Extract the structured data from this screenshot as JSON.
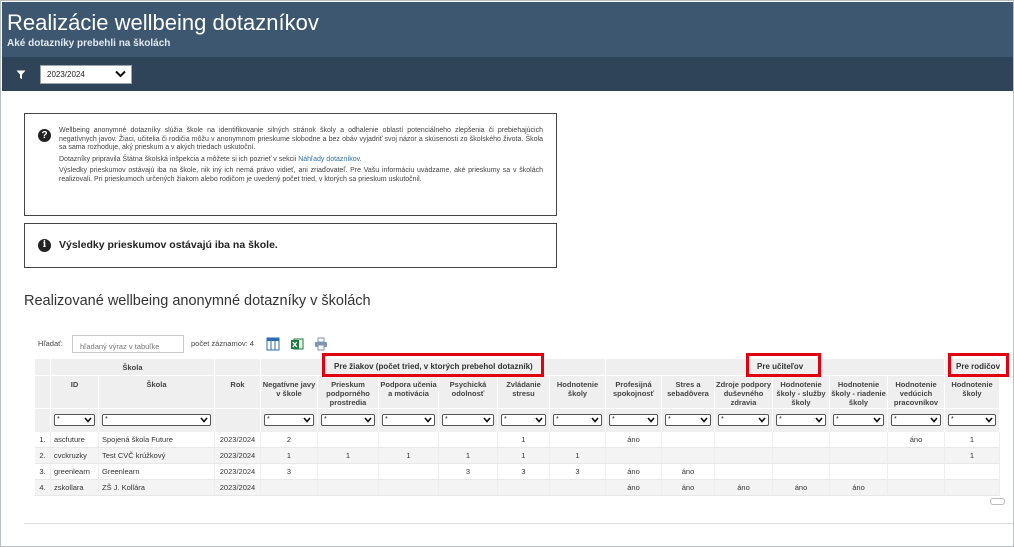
{
  "header": {
    "title": "Realizácie wellbeing dotazníkov",
    "subtitle": "Aké dotazníky prebehli na školách"
  },
  "toolbar": {
    "filter_icon": "filter-icon",
    "year": "2023/2024"
  },
  "info": {
    "p1": "Wellbeing anonymné dotazníky slúžia škole na identifikovanie silných stránok školy a odhalenie oblastí potenciálneho zlepšenia či prebiehajúcich negatívnych javov. Žiaci, učitelia či rodičia môžu v anonymnom prieskume slobodne a bez obáv vyjadriť svoj názor a skúsenosti zo školského života. Škola sa sama rozhoduje, aký prieskum a v akých triedach uskutoční.",
    "p2_prefix": "Dotazníky pripravila Štátna školská inšpekcia a môžete si ich pozrieť v sekcii",
    "p2_link": "Náhľady dotazníkov",
    "p2_suffix": ".",
    "p3": "Výsledky prieskumov ostávajú iba na škole, nik iný ich nemá právo vidieť, ani zriaďovateľ. Pre Vašu informáciu uvádzame, aké prieskumy sa v školách realizovali. Pri prieskumoch určených žiakom alebo rodičom je uvedený počet tried, v ktorých sa prieskum uskutočnil.",
    "notice": "Výsledky prieskumov ostávajú iba na škole."
  },
  "section_title": "Realizované wellbeing anonymné dotazníky v školách",
  "search": {
    "label": "Hľadať:",
    "placeholder": "hľadaný výraz v tabuľke",
    "record_count": "počet záznamov: 4"
  },
  "groups": {
    "skola": "Škola",
    "ziaci": "Pre žiakov (počet tried, v ktorých prebehol dotazník)",
    "ucitelia": "Pre učiteľov",
    "rodicia": "Pre rodičov"
  },
  "columns": [
    "ID",
    "Škola",
    "Rok",
    "Negatívne javy v škole",
    "Prieskum podporného prostredia",
    "Podpora učenia a motivácia",
    "Psychická odolnosť",
    "Zvládanie stresu",
    "Hodnotenie školy",
    "Profesijná spokojnosť",
    "Stres a sebadôvera",
    "Zdroje podpory duševného zdravia",
    "Hodnotenie školy - služby školy",
    "Hodnotenie školy - riadenie školy",
    "Hodnotenie vedúcich pracovníkov",
    "Hodnotenie školy"
  ],
  "filter_values": {
    "id": "*",
    "default": "*"
  },
  "rows": [
    {
      "n": "1.",
      "cells": [
        "ascfuture",
        "Spojená škola Future",
        "2023/2024",
        "2",
        "",
        "",
        "",
        "1",
        "",
        "áno",
        "",
        "",
        "",
        "",
        "áno",
        "1"
      ]
    },
    {
      "n": "2.",
      "cells": [
        "cvckruzky",
        "Test CVČ krúžkový",
        "2023/2024",
        "1",
        "1",
        "1",
        "1",
        "1",
        "1",
        "",
        "",
        "",
        "",
        "",
        "",
        "1"
      ]
    },
    {
      "n": "3.",
      "cells": [
        "greenlearn",
        "Greenlearn",
        "2023/2024",
        "3",
        "",
        "",
        "3",
        "3",
        "3",
        "áno",
        "áno",
        "",
        "",
        "",
        "",
        ""
      ]
    },
    {
      "n": "4.",
      "cells": [
        "zskollara",
        "ZŠ J. Kollára",
        "2023/2024",
        "",
        "",
        "",
        "",
        "",
        "",
        "áno",
        "áno",
        "áno",
        "áno",
        "áno",
        "",
        ""
      ]
    }
  ]
}
